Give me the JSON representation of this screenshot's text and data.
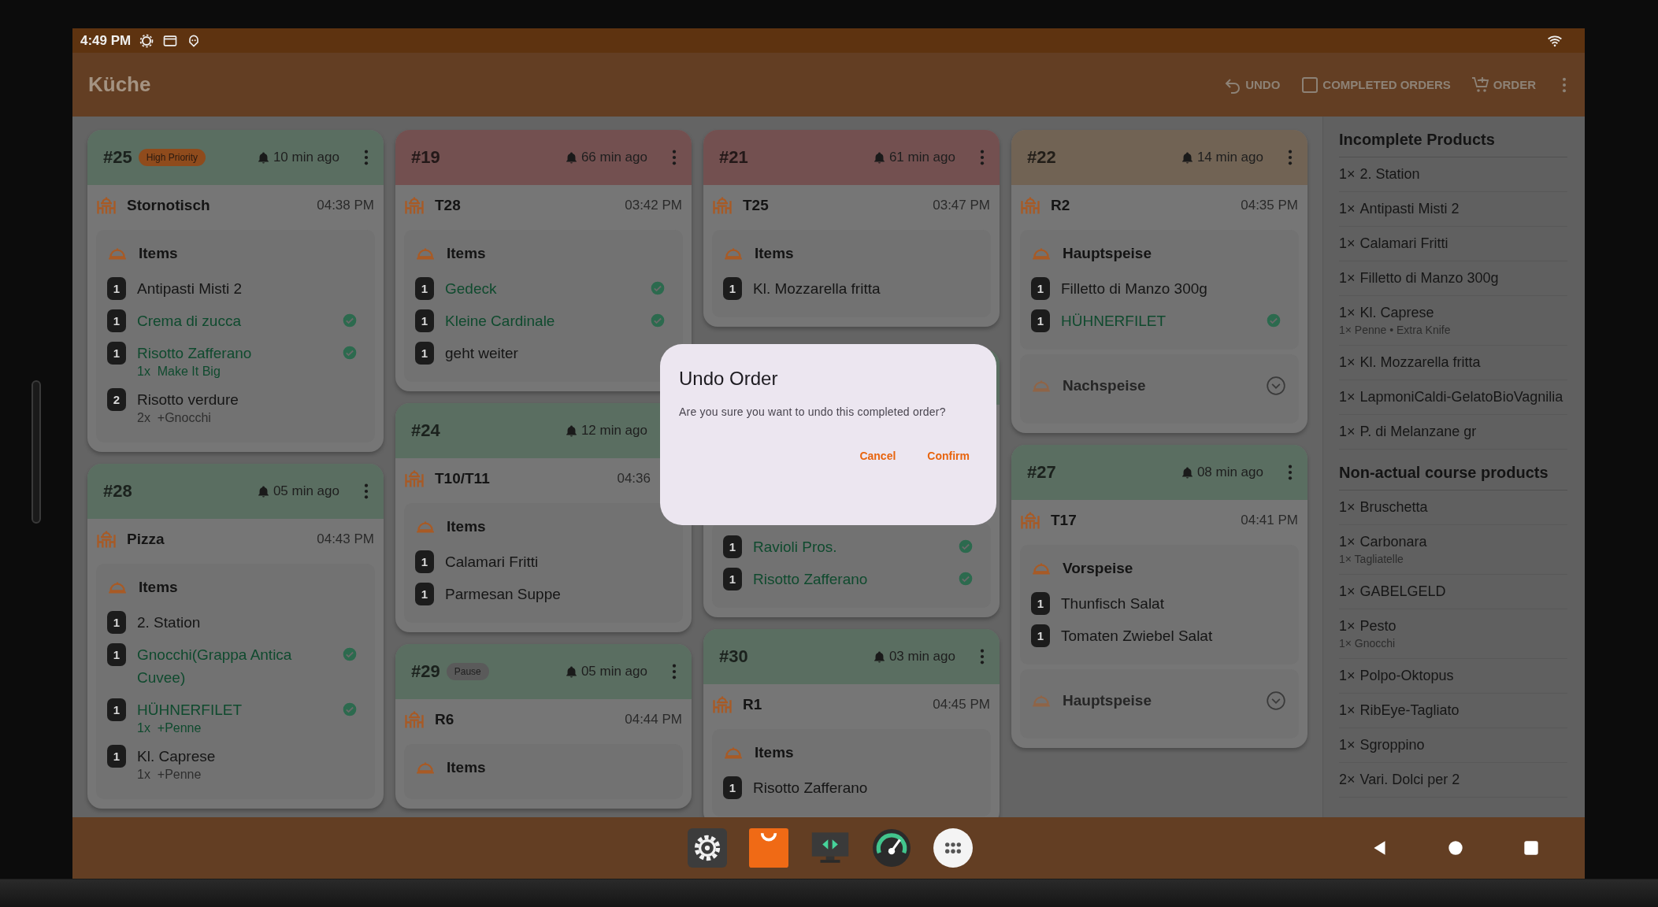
{
  "status_bar": {
    "time": "4:49 PM"
  },
  "app_bar": {
    "title": "Küche",
    "actions": [
      {
        "label": "UNDO"
      },
      {
        "label": "COMPLETED ORDERS"
      },
      {
        "label": "ORDER"
      }
    ]
  },
  "columns": [
    {
      "cards": [
        {
          "kind": "order",
          "color": "#5a6e61",
          "number": "#25",
          "badge": {
            "kind": "priority",
            "text": "High Priority"
          },
          "age": "10 min ago",
          "table": "Stornotisch",
          "time": "04:38 PM",
          "sections": [
            {
              "title": "Items",
              "expanded": true,
              "items": [
                {
                  "qty": "1",
                  "name": "Antipasti Misti 2",
                  "done": false
                },
                {
                  "qty": "1",
                  "name": "Crema di zucca",
                  "done": true
                },
                {
                  "qty": "1",
                  "name": "Risotto Zafferano",
                  "done": true,
                  "modifiers": [
                    "1x  Make It Big"
                  ]
                },
                {
                  "qty": "2",
                  "name": "Risotto verdure",
                  "done": false,
                  "modifiers": [
                    "2x  +Gnocchi"
                  ]
                }
              ]
            }
          ]
        },
        {
          "kind": "order",
          "color": "#5a6e61",
          "number": "#28",
          "age": "05 min ago",
          "table": "Pizza",
          "time": "04:43 PM",
          "sections": [
            {
              "title": "Items",
              "expanded": true,
              "items": [
                {
                  "qty": "1",
                  "name": "2. Station",
                  "done": false
                },
                {
                  "qty": "1",
                  "name": "Gnocchi(Grappa Antica Cuvee)",
                  "done": true
                },
                {
                  "qty": "1",
                  "name": "HÜHNERFILET",
                  "done": true,
                  "modifiers": [
                    "1x  +Penne"
                  ]
                },
                {
                  "qty": "1",
                  "name": "Kl. Caprese",
                  "done": false,
                  "modifiers": [
                    "1x  +Penne"
                  ]
                }
              ]
            }
          ]
        }
      ]
    },
    {
      "cards": [
        {
          "kind": "order",
          "color": "#735050",
          "number": "#19",
          "age": "66 min ago",
          "table": "T28",
          "time": "03:42 PM",
          "sections": [
            {
              "title": "Items",
              "expanded": true,
              "items": [
                {
                  "qty": "1",
                  "name": "Gedeck",
                  "done": true
                },
                {
                  "qty": "1",
                  "name": "Kleine Cardinale",
                  "done": true
                },
                {
                  "qty": "1",
                  "name": "geht weiter",
                  "done": false
                }
              ]
            }
          ]
        },
        {
          "kind": "order",
          "color": "#5a6e61",
          "number": "#24",
          "age": "12 min ago",
          "table": "T10/T11",
          "time": "04:36",
          "sections": [
            {
              "title": "Items",
              "expanded": true,
              "items": [
                {
                  "qty": "1",
                  "name": "Calamari Fritti",
                  "done": false
                },
                {
                  "qty": "1",
                  "name": "Parmesan Suppe",
                  "done": false
                }
              ]
            }
          ]
        },
        {
          "kind": "order",
          "color": "#5a6e61",
          "number": "#29",
          "badge": {
            "kind": "pause",
            "text": "Pause"
          },
          "age": "05 min ago",
          "table": "R6",
          "time": "04:44 PM",
          "sections": [
            {
              "title": "Items",
              "expanded": true
            }
          ]
        }
      ]
    },
    {
      "cards": [
        {
          "kind": "order",
          "color": "#735050",
          "number": "#21",
          "age": "61 min ago",
          "table": "T25",
          "time": "03:47 PM",
          "sections": [
            {
              "title": "Items",
              "expanded": true,
              "items": [
                {
                  "qty": "1",
                  "name": "Kl. Mozzarella fritta",
                  "done": false
                }
              ]
            }
          ]
        },
        {
          "kind": "partial",
          "color": "#5a6e61",
          "items": [
            {
              "qty": "1",
              "name": "Ravioli Pros.",
              "done": true
            },
            {
              "qty": "1",
              "name": "Risotto Zafferano",
              "done": true
            }
          ]
        },
        {
          "kind": "order",
          "color": "#5a6e61",
          "number": "#30",
          "age": "03 min ago",
          "table": "R1",
          "time": "04:45 PM",
          "sections": [
            {
              "title": "Items",
              "expanded": true,
              "items": [
                {
                  "qty": "1",
                  "name": "Risotto Zafferano",
                  "done": false
                }
              ]
            }
          ]
        }
      ]
    },
    {
      "cards": [
        {
          "kind": "order",
          "color": "#716354",
          "number": "#22",
          "age": "14 min ago",
          "table": "R2",
          "time": "04:35 PM",
          "sections": [
            {
              "title": "Hauptspeise",
              "expanded": true,
              "items": [
                {
                  "qty": "1",
                  "name": "Filletto di Manzo 300g",
                  "done": false
                },
                {
                  "qty": "1",
                  "name": "HÜHNERFILET",
                  "done": true
                }
              ]
            },
            {
              "title": "Nachspeise",
              "expanded": false
            }
          ]
        },
        {
          "kind": "order",
          "color": "#5a6e61",
          "number": "#27",
          "age": "08 min ago",
          "table": "T17",
          "time": "04:41 PM",
          "sections": [
            {
              "title": "Vorspeise",
              "expanded": true,
              "items": [
                {
                  "qty": "1",
                  "name": "Thunfisch Salat",
                  "done": false
                },
                {
                  "qty": "1",
                  "name": "Tomaten Zwiebel Salat",
                  "done": false
                }
              ]
            },
            {
              "title": "Hauptspeise",
              "expanded": false
            }
          ]
        }
      ]
    }
  ],
  "sidebar": {
    "sections": [
      {
        "title": "Incomplete Products",
        "rows": [
          {
            "qty": "1×",
            "name": "2. Station"
          },
          {
            "qty": "1×",
            "name": "Antipasti Misti 2"
          },
          {
            "qty": "1×",
            "name": "Calamari Fritti"
          },
          {
            "qty": "1×",
            "name": "Filletto di Manzo 300g"
          },
          {
            "qty": "1×",
            "name": "Kl. Caprese",
            "detail": "1× Penne • Extra Knife"
          },
          {
            "qty": "1×",
            "name": "Kl. Mozzarella fritta"
          },
          {
            "qty": "1×",
            "name": "LapmoniCaldi-GelatoBioVagnilia"
          },
          {
            "qty": "1×",
            "name": "P. di Melanzane gr"
          }
        ]
      },
      {
        "title": "Non-actual course products",
        "rows": [
          {
            "qty": "1×",
            "name": "Bruschetta"
          },
          {
            "qty": "1×",
            "name": "Carbonara",
            "detail": "1× Tagliatelle"
          },
          {
            "qty": "1×",
            "name": "GABELGELD"
          },
          {
            "qty": "1×",
            "name": "Pesto",
            "detail": "1× Gnocchi"
          },
          {
            "qty": "1×",
            "name": "Polpo-Oktopus"
          },
          {
            "qty": "1×",
            "name": "RibEye-Tagliato"
          },
          {
            "qty": "1×",
            "name": "Sgroppino"
          },
          {
            "qty": "2×",
            "name": "Vari. Dolci per 2"
          }
        ]
      }
    ]
  },
  "dialog": {
    "title": "Undo Order",
    "message": "Are you sure you want to undo this completed order?",
    "buttons": [
      "Cancel",
      "Confirm"
    ]
  }
}
